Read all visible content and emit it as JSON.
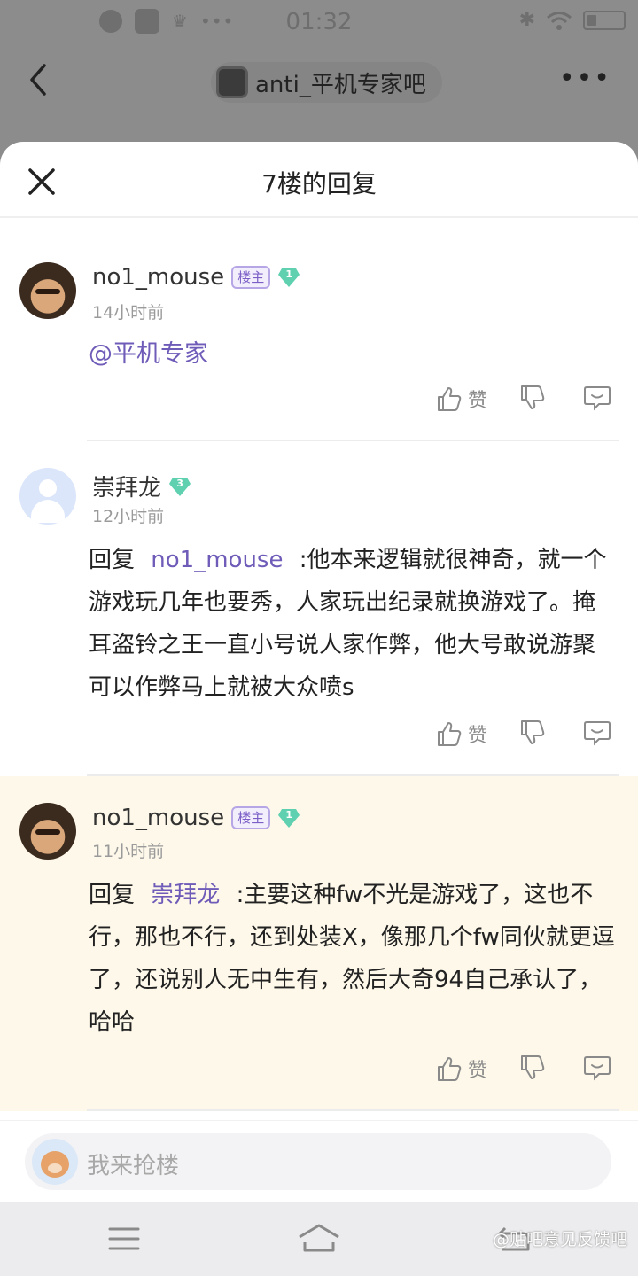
{
  "status_bar": {
    "time": "01:32"
  },
  "top_nav": {
    "forum_name": "anti_平机专家吧"
  },
  "sheet": {
    "title": "7楼的回复"
  },
  "replies": [
    {
      "username": "no1_mouse",
      "host_badge": "楼主",
      "level": "1",
      "time": "14小时前",
      "mention_only": "@平机专家",
      "like_label": "赞"
    },
    {
      "username": "崇拜龙",
      "level": "3",
      "time": "12小时前",
      "reply_prefix": "回复",
      "reply_to": "no1_mouse",
      "text": ":他本来逻辑就很神奇，就一个游戏玩几年也要秀，人家玩出纪录就换游戏了。掩耳盗铃之王一直小号说人家作弊，他大号敢说游聚可以作弊马上就被大众喷s",
      "like_label": "赞"
    },
    {
      "username": "no1_mouse",
      "host_badge": "楼主",
      "level": "1",
      "time": "11小时前",
      "reply_prefix": "回复",
      "reply_to": "崇拜龙",
      "text": ":主要这种fw不光是游戏了，这也不行，那也不行，还到处装X，像那几个fw同伙就更逗了，还说别人无中生有，然后大奇94自己承认了，哈哈",
      "like_label": "赞"
    }
  ],
  "comment_bar": {
    "placeholder": "我来抢楼"
  },
  "watermark": "@贴吧意见反馈吧",
  "colors": {
    "accent": "#6f5bb8",
    "highlight_bg": "#fdf8e9",
    "level_gem": "#5fd0b0"
  },
  "icons": [
    "back-icon",
    "more-icon",
    "close-icon",
    "like-icon",
    "dislike-icon",
    "comment-icon",
    "menu-icon",
    "home-icon",
    "return-icon"
  ]
}
